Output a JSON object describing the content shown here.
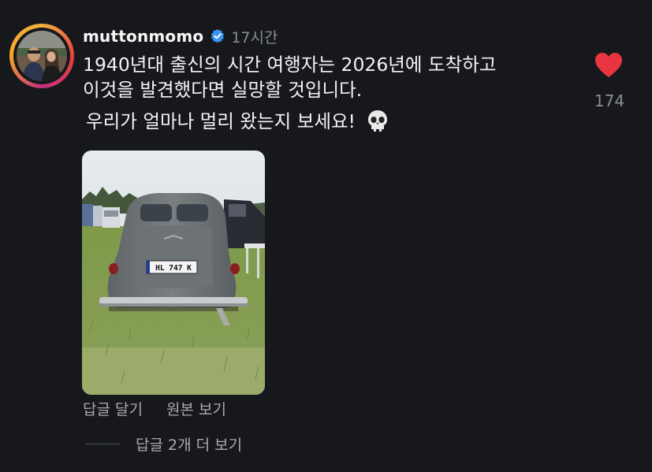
{
  "post": {
    "username": "muttonmomo",
    "timestamp": "17시간",
    "text_line1": "1940년대 출신의 시간 여행자는 2026년에 도착하고",
    "text_line2": "이것을 발견했다면 실망할 것입니다.",
    "text_line3": "우리가 얼마나 멀리 왔는지 보세요!",
    "like_count": "174",
    "plate_text": "HL 747 K"
  },
  "actions": {
    "reply": "답글 달기",
    "view_original": "원본 보기",
    "more_replies": "답글 2개 더 보기"
  },
  "icons": {
    "verified": "verified-badge-icon",
    "skull": "skull-emoji-icon",
    "heart": "heart-icon"
  },
  "colors": {
    "background": "#16181c",
    "heart": "#e8353f",
    "verified": "#3897f0",
    "muted_text": "#8a8d91"
  }
}
